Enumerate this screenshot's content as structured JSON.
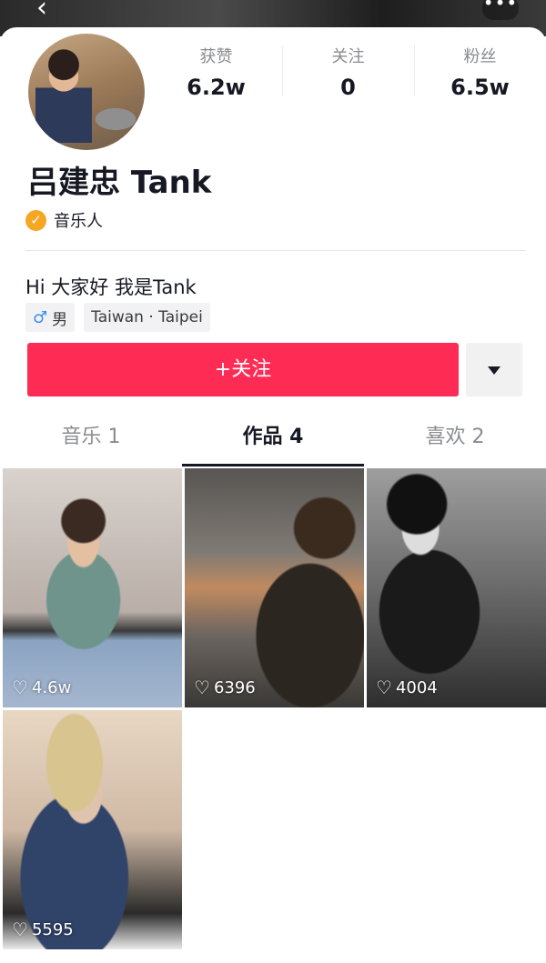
{
  "header": {
    "back_icon": "chevron-left-icon",
    "more_label": "•••"
  },
  "profile": {
    "name": "吕建忠 Tank",
    "verification": "音乐人",
    "bio": "Hi 大家好 我是Tank",
    "gender_symbol": "♂",
    "gender": "男",
    "location": "Taiwan · Taipei"
  },
  "stats": [
    {
      "label": "获赞",
      "value": "6.2w"
    },
    {
      "label": "关注",
      "value": "0"
    },
    {
      "label": "粉丝",
      "value": "6.5w"
    }
  ],
  "actions": {
    "follow_label": "+关注"
  },
  "tabs": [
    {
      "label": "音乐 1",
      "active": false
    },
    {
      "label": "作品 4",
      "active": true
    },
    {
      "label": "喜欢 2",
      "active": false
    }
  ],
  "videos": [
    {
      "likes": "4.6w"
    },
    {
      "likes": "6396"
    },
    {
      "likes": "4004"
    },
    {
      "likes": "5595"
    }
  ],
  "colors": {
    "accent": "#fe2c55",
    "verify": "#f5a623",
    "male": "#3a8df0"
  }
}
